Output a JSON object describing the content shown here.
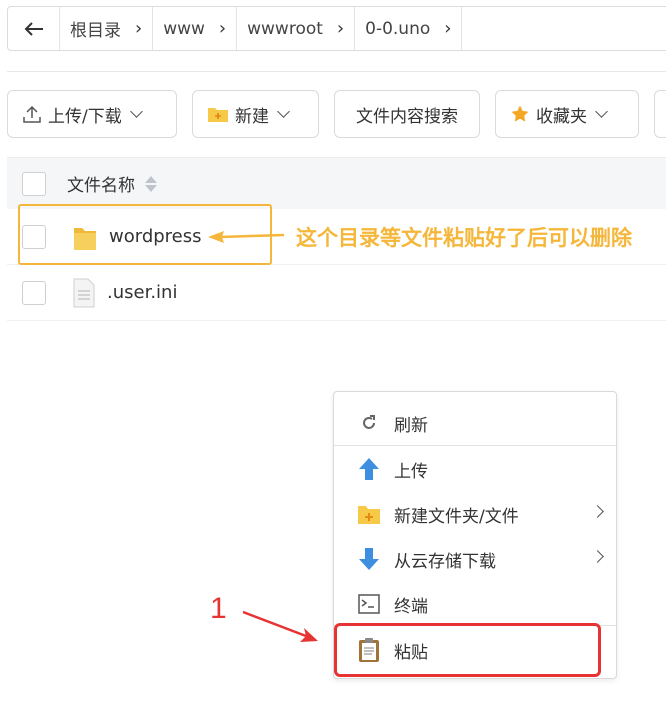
{
  "breadcrumb": {
    "items": [
      "根目录",
      "www",
      "wwwroot",
      "0-0.uno"
    ]
  },
  "toolbar": {
    "upload_download": "上传/下载",
    "new": "新建",
    "search_content": "文件内容搜索",
    "favorites": "收藏夹"
  },
  "table": {
    "header_name": "文件名称",
    "rows": [
      {
        "name": "wordpress",
        "type": "folder"
      },
      {
        "name": ".user.ini",
        "type": "file"
      }
    ]
  },
  "annotation": {
    "note": "这个目录等文件粘贴好了后可以删除",
    "step": "1"
  },
  "context_menu": {
    "items": [
      {
        "label": "刷新",
        "icon": "refresh-icon"
      },
      {
        "label": "上传",
        "icon": "upload-arrow-icon"
      },
      {
        "label": "新建文件夹/文件",
        "icon": "new-folder-icon"
      },
      {
        "label": "从云存储下载",
        "icon": "download-arrow-icon"
      },
      {
        "label": "终端",
        "icon": "terminal-icon"
      },
      {
        "label": "粘贴",
        "icon": "clipboard-icon"
      }
    ]
  },
  "colors": {
    "annotation_yellow": "#f5b73b",
    "highlight_red": "#e63333",
    "arrow_blue": "#3f8fe0",
    "folder_yellow": "#f7c948"
  }
}
